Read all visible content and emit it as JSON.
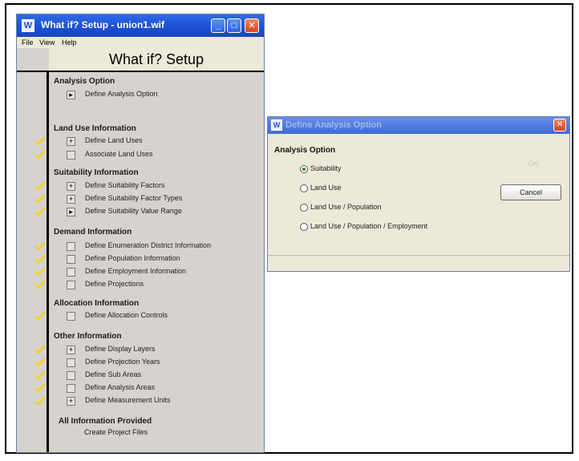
{
  "main_window": {
    "title": "What if? Setup - union1.wif",
    "menu": [
      "File",
      "View",
      "Help"
    ],
    "setup_title": "What if? Setup"
  },
  "sections": [
    {
      "label": "Analysis Option",
      "items": [
        {
          "label": "Define Analysis Option",
          "box": "▸",
          "checked": false
        }
      ]
    },
    {
      "label": "Land Use Information",
      "items": [
        {
          "label": "Define Land Uses",
          "box": "+",
          "checked": true
        },
        {
          "label": "Associate Land Uses",
          "box": "",
          "checked": true
        }
      ]
    },
    {
      "label": "Suitability Information",
      "items": [
        {
          "label": "Define Suitability Factors",
          "box": "+",
          "checked": true
        },
        {
          "label": "Define Suitability Factor Types",
          "box": "+",
          "checked": true
        },
        {
          "label": "Define Suitability Value Range",
          "box": "▸",
          "checked": true
        }
      ]
    },
    {
      "label": "Demand Information",
      "items": [
        {
          "label": "Define Enumeration District Information",
          "box": "",
          "checked": true
        },
        {
          "label": "Define Population Information",
          "box": "",
          "checked": true
        },
        {
          "label": "Define Employment Information",
          "box": "",
          "checked": true
        },
        {
          "label": "Define Projections",
          "box": "",
          "checked": true
        }
      ]
    },
    {
      "label": "Allocation Information",
      "items": [
        {
          "label": "Define Allocation Controls",
          "box": "",
          "checked": true
        }
      ]
    },
    {
      "label": "Other Information",
      "items": [
        {
          "label": "Define Display Layers",
          "box": "+",
          "checked": true
        },
        {
          "label": "Define Projection Years",
          "box": "",
          "checked": true
        },
        {
          "label": "Define Sub Areas",
          "box": "",
          "checked": true
        },
        {
          "label": "Define Analysis Areas",
          "box": "",
          "checked": true
        },
        {
          "label": "Define Measurement Units",
          "box": "+",
          "checked": true
        }
      ]
    }
  ],
  "final_section": {
    "label": "All Information Provided",
    "item": "Create Project Files"
  },
  "dialog": {
    "title": "Define Analysis Option",
    "group_label": "Analysis Option",
    "options": [
      {
        "label": "Suitability",
        "selected": true
      },
      {
        "label": "Land Use",
        "selected": false
      },
      {
        "label": "Land Use / Population",
        "selected": false
      },
      {
        "label": "Land Use / Population / Employment",
        "selected": false
      }
    ],
    "ok_label": "OK",
    "cancel_label": "Cancel"
  },
  "colors": {
    "check": "#f2d12e",
    "titlebar": "#1b4fd1",
    "radio_selected": "#2a8a2a"
  }
}
